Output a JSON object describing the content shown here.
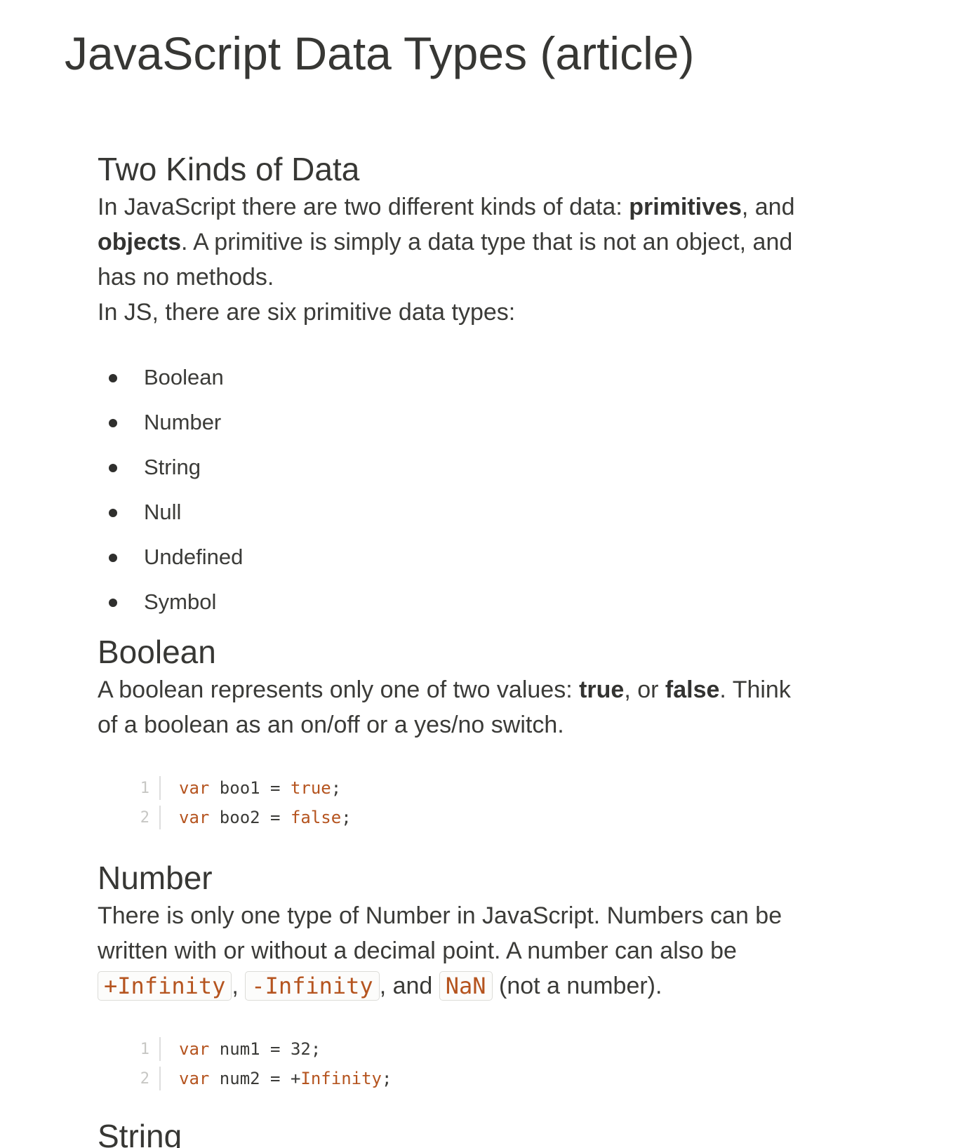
{
  "title": "JavaScript Data Types (article)",
  "sections": {
    "two_kinds": {
      "heading": "Two Kinds of Data",
      "para1": {
        "t1": "In JavaScript there are two different kinds of data: ",
        "b1": "primitives",
        "t2": ", and ",
        "b2": "objects",
        "t3": ". A primitive is simply a data type that is not an object, and has no methods."
      },
      "para2": "In JS, there are six primitive data types:",
      "types": [
        "Boolean",
        "Number",
        "String",
        "Null",
        "Undefined",
        "Symbol"
      ]
    },
    "boolean": {
      "heading": "Boolean",
      "para": {
        "t1": "A boolean represents only one of two values: ",
        "b1": "true",
        "t2": ", or ",
        "b2": "false",
        "t3": ". Think of a boolean as an on/off or a yes/no switch."
      },
      "code": [
        {
          "ln": "1",
          "kw": "var",
          "rest": " boo1 = ",
          "lit": "true",
          "end": ";"
        },
        {
          "ln": "2",
          "kw": "var",
          "rest": " boo2 = ",
          "lit": "false",
          "end": ";"
        }
      ]
    },
    "number": {
      "heading": "Number",
      "para": {
        "t1": "There is only one type of Number in JavaScript. Numbers can be written with or without a decimal point. A number can also be ",
        "c1": "+Infinity",
        "t2": ", ",
        "c2": "-Infinity",
        "t3": ", and ",
        "c3": "NaN",
        "t4": " (not a number)."
      },
      "code": [
        {
          "ln": "1",
          "kw": "var",
          "rest": " num1 = 32",
          "lit": "",
          "end": ";"
        },
        {
          "ln": "2",
          "kw": "var",
          "rest": " num2 = +",
          "lit": "Infinity",
          "end": ";"
        }
      ]
    },
    "string": {
      "heading": "String"
    }
  },
  "colors": {
    "text": "#3b3b38",
    "code_accent": "#b5541f",
    "line_number": "#c7c7c4"
  }
}
